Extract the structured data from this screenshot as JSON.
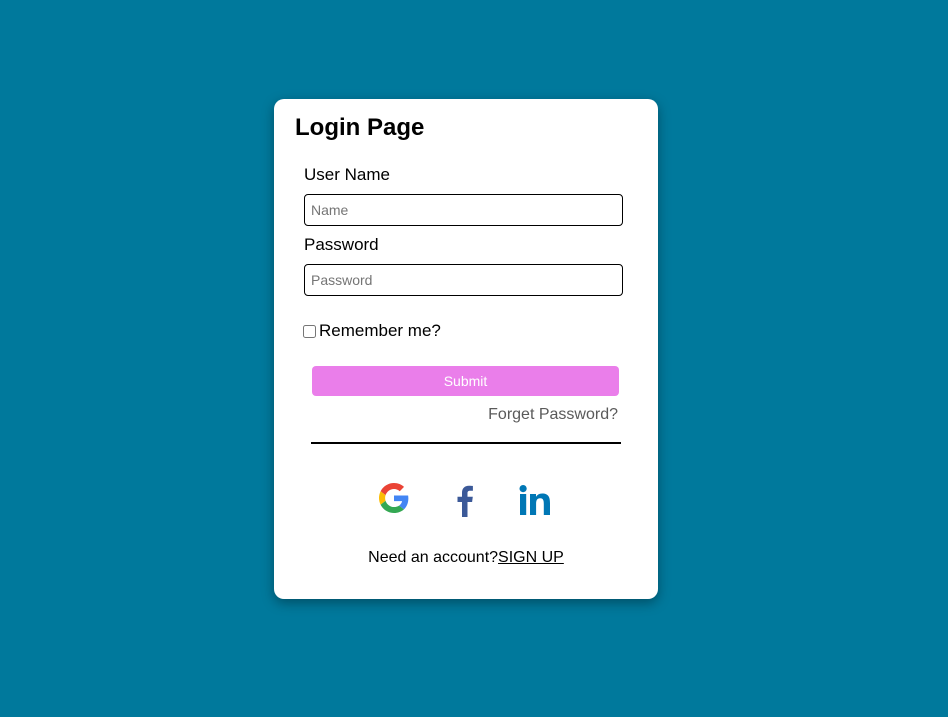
{
  "page": {
    "background_color": "#00799c"
  },
  "card": {
    "title": "Login Page",
    "username": {
      "label": "User Name",
      "placeholder": "Name",
      "value": ""
    },
    "password": {
      "label": "Password",
      "placeholder": "Password",
      "value": ""
    },
    "remember": {
      "label": "Remember me?",
      "checked": false
    },
    "submit": {
      "label": "Submit",
      "color": "#ea7eea"
    },
    "forgot_password": "Forget Password?",
    "social": [
      {
        "name": "google",
        "icon": "google-icon"
      },
      {
        "name": "facebook",
        "icon": "facebook-icon",
        "color": "#3b5998"
      },
      {
        "name": "linkedin",
        "icon": "linkedin-icon",
        "color": "#0077b5"
      }
    ],
    "signup": {
      "prompt": "Need an account?",
      "link_label": "SIGN UP"
    }
  }
}
